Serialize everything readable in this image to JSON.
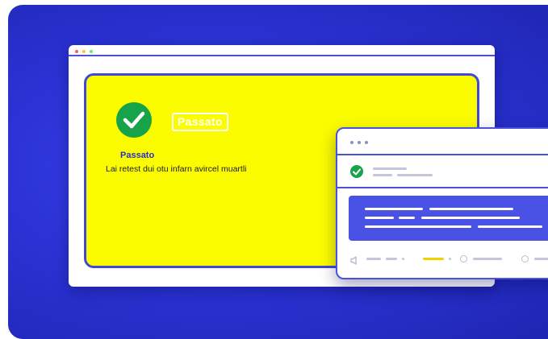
{
  "status": {
    "badge_label": "Passato",
    "title": "Passato",
    "description": "Lai retest dui otu infarn avircel muartli"
  },
  "colors": {
    "background": "#2b33d6",
    "panel": "#fcfc00",
    "accent": "#4a51e0",
    "success": "#16a34a",
    "highlight": "#f2d100"
  },
  "icons": {
    "status": "check-circle-icon",
    "row": "check-circle-small-icon",
    "audio": "speaker-icon"
  }
}
